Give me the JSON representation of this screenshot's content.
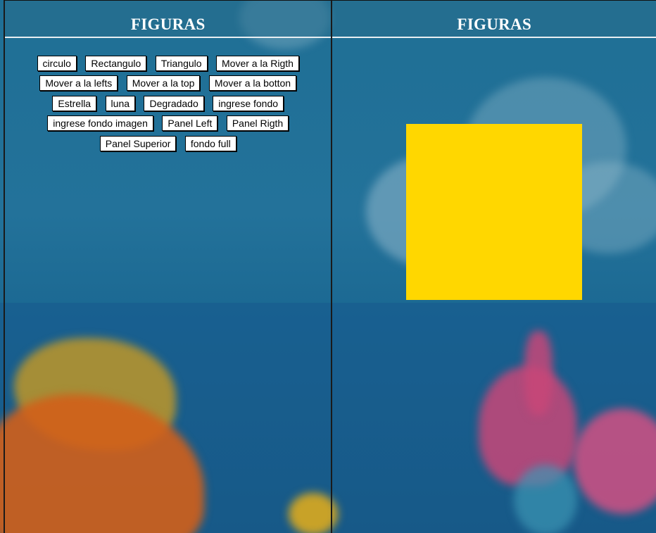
{
  "left_panel": {
    "title": "FIGURAS",
    "buttons": [
      "circulo",
      "Rectangulo",
      "Triangulo",
      "Mover a la Rigth",
      "Mover a la lefts",
      "Mover a la top",
      "Mover a la botton",
      "Estrella",
      "luna",
      "Degradado",
      "ingrese fondo",
      "ingrese fondo imagen",
      "Panel Left",
      "Panel Rigth",
      "Panel Superior",
      "fondo full"
    ]
  },
  "right_panel": {
    "title": "FIGURAS",
    "shape": {
      "type": "square",
      "color": "#FFD700"
    }
  },
  "colors": {
    "button_background": "#FFFFFF",
    "title_text": "#FFFFFF",
    "panel_divider": "#1A1A1A"
  }
}
